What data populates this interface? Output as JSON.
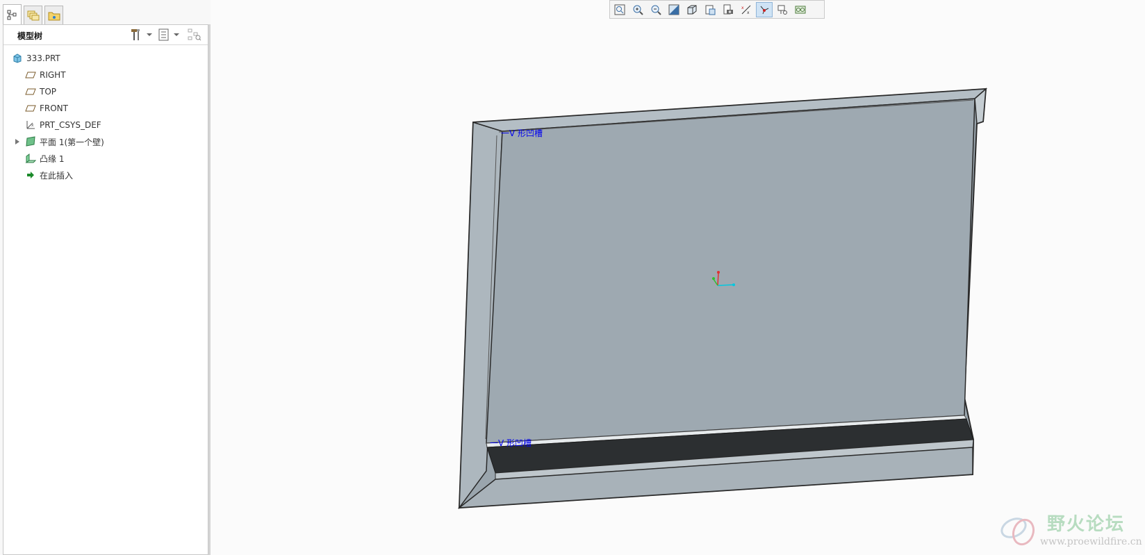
{
  "panel_tabs": [
    {
      "icon": "model-tree-icon",
      "active": true
    },
    {
      "icon": "layers-icon",
      "active": false
    },
    {
      "icon": "favorites-folder-icon",
      "active": false
    }
  ],
  "tree_header": {
    "title": "模型树",
    "settings_icon": "tools-icon",
    "show_icon": "tree-columns-icon",
    "filter_icon": "tree-filter-icon"
  },
  "model_tree": {
    "items": [
      {
        "label": "333.PRT",
        "icon": "part-icon"
      },
      {
        "label": "RIGHT",
        "icon": "datum-plane-icon"
      },
      {
        "label": "TOP",
        "icon": "datum-plane-icon"
      },
      {
        "label": "FRONT",
        "icon": "datum-plane-icon"
      },
      {
        "label": "PRT_CSYS_DEF",
        "icon": "coordinate-system-icon"
      },
      {
        "label": "平面 1(第一个壁)",
        "icon": "planar-wall-icon"
      },
      {
        "label": "凸缘 1",
        "icon": "flange-icon"
      },
      {
        "label": "在此插入",
        "icon": "insert-here-arrow-icon"
      }
    ]
  },
  "view_toolbar": {
    "buttons": [
      "refit-icon",
      "zoom-in-icon",
      "zoom-out-icon",
      "repaint-icon",
      "display-style-icon",
      "saved-views-icon",
      "view-manager-icon",
      "datum-planes-toggle-icon",
      "datum-axes-toggle-icon",
      "datum-points-toggle-icon",
      "csys-toggle-icon",
      "annotations-toggle-icon"
    ],
    "active_index": 9
  },
  "viewport": {
    "notch_labels": [
      "一V 形凹槽",
      "一V 形凹槽"
    ],
    "colors": {
      "sheet_face": "#9ea9b1",
      "sheet_edge": "#2b2b2b",
      "groove_dark": "#2c2f31",
      "csys_x": "#00c8e0",
      "csys_y": "#e03030",
      "csys_z": "#30c030"
    }
  },
  "watermark": {
    "name": "野火论坛",
    "url": "www.proewildfire.cn"
  }
}
